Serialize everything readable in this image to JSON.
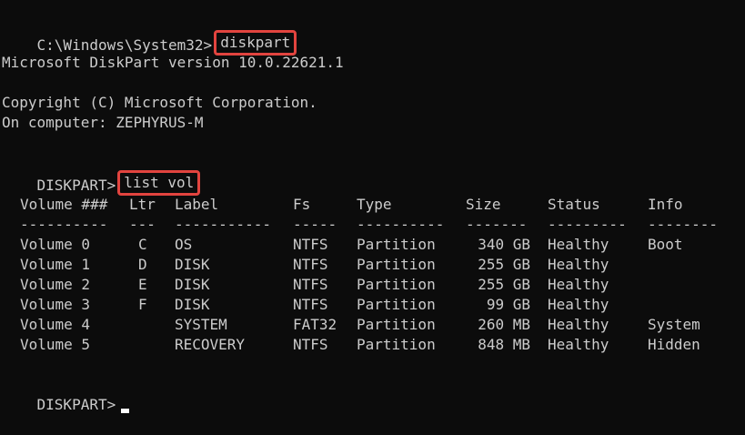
{
  "prompt1": "C:\\Windows\\System32>",
  "cmd1": "diskpart",
  "version_line": "Microsoft DiskPart version 10.0.22621.1",
  "copyright_line": "Copyright (C) Microsoft Corporation.",
  "computer_line": "On computer: ZEPHYRUS-M",
  "prompt2": "DISKPART>",
  "cmd2": "list vol",
  "headers": [
    "Volume ###",
    "Ltr",
    "Label",
    "Fs",
    "Type",
    "Size",
    "Status",
    "Info"
  ],
  "separators": [
    "----------",
    "---",
    "-----------",
    "-----",
    "----------",
    "-------",
    "---------",
    "--------"
  ],
  "rows": [
    [
      "Volume 0",
      "C",
      "OS",
      "NTFS",
      "Partition",
      "340 GB",
      "Healthy",
      "Boot"
    ],
    [
      "Volume 1",
      "D",
      "DISK",
      "NTFS",
      "Partition",
      "255 GB",
      "Healthy",
      ""
    ],
    [
      "Volume 2",
      "E",
      "DISK",
      "NTFS",
      "Partition",
      "255 GB",
      "Healthy",
      ""
    ],
    [
      "Volume 3",
      "F",
      "DISK",
      "NTFS",
      "Partition",
      "99 GB",
      "Healthy",
      ""
    ],
    [
      "Volume 4",
      "",
      "SYSTEM",
      "FAT32",
      "Partition",
      "260 MB",
      "Healthy",
      "System"
    ],
    [
      "Volume 5",
      "",
      "RECOVERY",
      "NTFS",
      "Partition",
      "848 MB",
      "Healthy",
      "Hidden"
    ]
  ],
  "prompt3": "DISKPART>",
  "colors": {
    "background": "#0c0c0c",
    "text": "#cccccc",
    "highlight": "#e2443f",
    "cursor": "#ffffff"
  }
}
